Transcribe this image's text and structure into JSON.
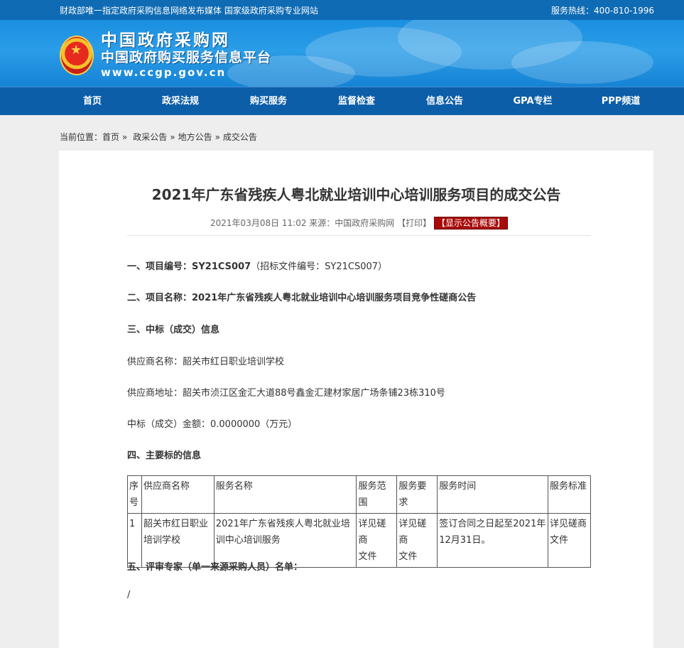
{
  "topbar": {
    "slogan": "财政部唯一指定政府采购信息网络发布媒体 国家级政府采购专业网站",
    "hotline": "服务热线：400-810-1996"
  },
  "banner": {
    "line1": "中国政府采购网",
    "line2": "中国政府购买服务信息平台",
    "line3": "www.ccgp.gov.cn"
  },
  "nav": [
    "首页",
    "政采法规",
    "购买服务",
    "监督检查",
    "信息公告",
    "GPA专栏",
    "PPP频道"
  ],
  "breadcrumb": {
    "prefix": "当前位置：",
    "items": [
      "首页",
      "政采公告",
      "地方公告",
      "成交公告"
    ],
    "separator": "»"
  },
  "article": {
    "title": "2021年广东省残疾人粤北就业培训中心培训服务项目的成交公告",
    "meta": "2021年03月08日 11:02 来源：中国政府采购网 【打印】",
    "show_summary": "【显示公告概要】",
    "project_no_label": "一、项目编号：",
    "project_no": "SY21CS007",
    "project_no_extra": "（招标文件编号：SY21CS007）",
    "project_name_label": "二、项目名称：",
    "project_name": "2021年广东省残疾人粤北就业培训中心培训服务项目竞争性磋商公告",
    "section3": "三、中标（成交）信息",
    "supplier_name": "供应商名称：韶关市红日职业培训学校",
    "supplier_address": "供应商地址：韶关市浈江区金汇大道88号鑫金汇建材家居广场条铺23栋310号",
    "amount": "中标（成交）金额：0.0000000（万元）",
    "section4": "四、主要标的信息",
    "section5": "五、评审专家（单一来源采购人员）名单：",
    "experts": "/"
  },
  "table": {
    "headers": [
      [
        "序",
        "号"
      ],
      [
        "供应商名称"
      ],
      [
        "服务名称"
      ],
      [
        "服务范围"
      ],
      [
        "服务要求"
      ],
      [
        "服务时间"
      ],
      [
        "服务标准"
      ]
    ],
    "row": [
      [
        "1"
      ],
      [
        "韶关市红日职业",
        "培训学校"
      ],
      [
        "2021年广东省残疾人粤北就业培",
        "训中心培训服务"
      ],
      [
        "详见磋商",
        "文件"
      ],
      [
        "详见磋商",
        "文件"
      ],
      [
        "签订合同之日起至2021年",
        "12月31日。"
      ],
      [
        "详见磋商",
        "文件"
      ]
    ]
  }
}
